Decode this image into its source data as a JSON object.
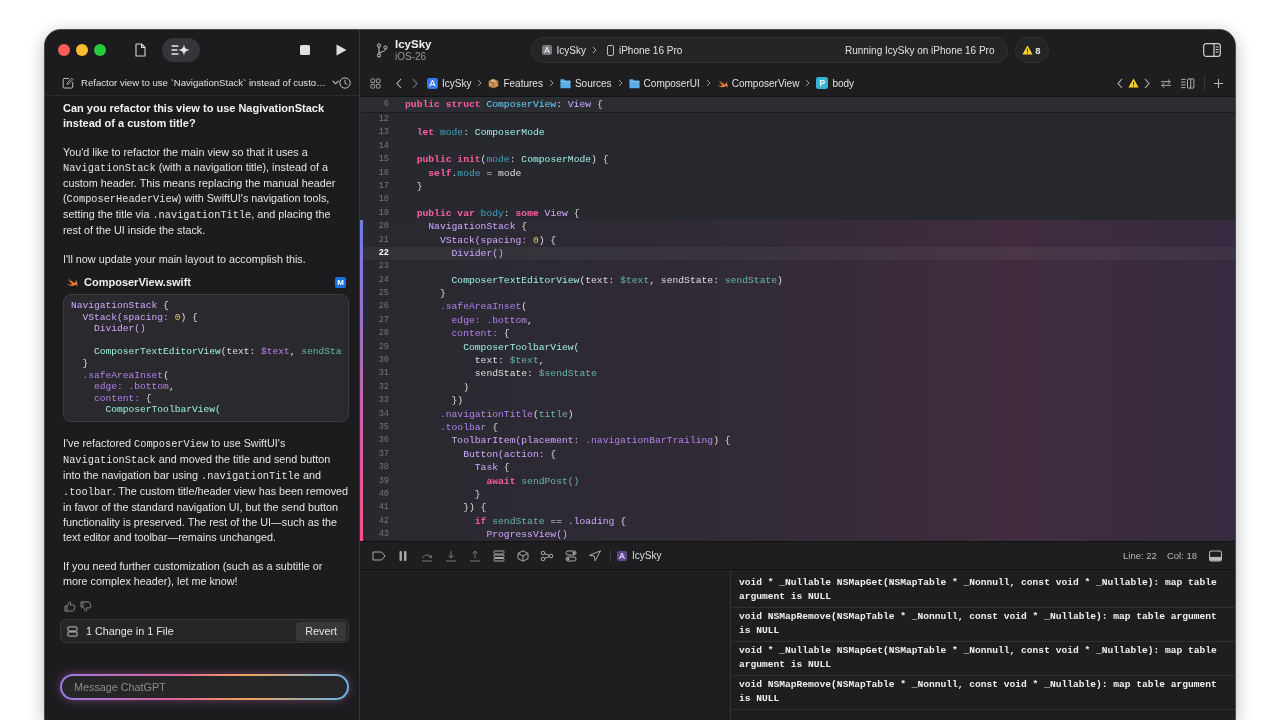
{
  "toolbar": {
    "assistant_toggle": {
      "selected": true
    },
    "project": {
      "name": "IcySky",
      "branch": "iOS-26"
    },
    "scheme": "IcySky",
    "destination": "iPhone 16 Pro",
    "status": "Running IcySky on iPhone 16 Pro",
    "warnings": "8"
  },
  "chat": {
    "title": "Refactor view to use `NavigationStack` instead of custo…",
    "items": [
      {
        "kind": "question",
        "text": "Can you refactor this view to use NagivationStack instead of a custom title?"
      },
      {
        "kind": "answer",
        "segments": [
          {
            "kind": "text",
            "text": "You'd like to refactor the main view so that it uses a "
          },
          {
            "kind": "code",
            "text": "NavigationStack"
          },
          {
            "kind": "text",
            "text": " (with a navigation title), instead of a custom header. This means replacing the manual header ("
          },
          {
            "kind": "code",
            "text": "ComposerHeaderView"
          },
          {
            "kind": "text",
            "text": ") with SwiftUI's navigation tools, setting the title via "
          },
          {
            "kind": "code",
            "text": ".navigationTitle"
          },
          {
            "kind": "text",
            "text": ", and placing the rest of the UI inside the stack."
          }
        ]
      },
      {
        "kind": "answer",
        "segments": [
          {
            "kind": "text",
            "text": "I'll now update your main layout to accomplish this."
          }
        ]
      },
      {
        "kind": "file",
        "name": "ComposerView.swift",
        "status": "M",
        "lines": [
          {
            "kind": "code",
            "tokens": [
              {
                "text": "NavigationStack",
                "kind": "type"
              },
              {
                "text": " {",
                "kind": "plain"
              }
            ]
          },
          {
            "kind": "code",
            "tokens": [
              {
                "text": "  VStack(spacing: ",
                "kind": "type"
              },
              {
                "text": "0",
                "kind": "number"
              },
              {
                "text": ") {",
                "kind": "plain"
              }
            ]
          },
          {
            "kind": "code",
            "tokens": [
              {
                "text": "    Divider()",
                "kind": "type"
              }
            ]
          },
          {
            "kind": "blank"
          },
          {
            "kind": "code",
            "tokens": [
              {
                "text": "    ComposerTextEditorView",
                "kind": "project"
              },
              {
                "text": "(text: ",
                "kind": "plain"
              },
              {
                "text": "$text",
                "kind": "member"
              },
              {
                "text": ", ",
                "kind": "plain"
              },
              {
                "text": "sendSta",
                "kind": "value"
              }
            ]
          },
          {
            "kind": "code",
            "tokens": [
              {
                "text": "  }",
                "kind": "plain"
              }
            ]
          },
          {
            "kind": "code",
            "tokens": [
              {
                "text": "  .safeAreaInset",
                "kind": "member"
              },
              {
                "text": "(",
                "kind": "plain"
              }
            ]
          },
          {
            "kind": "code",
            "tokens": [
              {
                "text": "    edge: .bottom",
                "kind": "member"
              },
              {
                "text": ",",
                "kind": "plain"
              }
            ]
          },
          {
            "kind": "code",
            "tokens": [
              {
                "text": "    content:",
                "kind": "member"
              },
              {
                "text": " {",
                "kind": "plain"
              }
            ]
          },
          {
            "kind": "code",
            "tokens": [
              {
                "text": "      ComposerToolbarView(",
                "kind": "project"
              }
            ]
          }
        ]
      },
      {
        "kind": "answer",
        "segments": [
          {
            "kind": "text",
            "text": "I've refactored "
          },
          {
            "kind": "code",
            "text": "ComposerView"
          },
          {
            "kind": "text",
            "text": " to use SwiftUI's "
          },
          {
            "kind": "code",
            "text": "NavigationStack"
          },
          {
            "kind": "text",
            "text": " and moved the title and send button into the navigation bar using "
          },
          {
            "kind": "code",
            "text": ".navigationTitle"
          },
          {
            "kind": "text",
            "text": " and "
          },
          {
            "kind": "code",
            "text": ".toolbar"
          },
          {
            "kind": "text",
            "text": ". The custom title/header view has been removed in favor of the standard navigation UI, but the send button functionality is preserved. The rest of the UI—such as the text editor and toolbar—remains unchanged."
          }
        ]
      },
      {
        "kind": "answer",
        "segments": [
          {
            "kind": "text",
            "text": "If you need further customization (such as a subtitle or more complex header), let me know!"
          }
        ]
      }
    ],
    "changes": {
      "summary": "1 Change in 1 File",
      "action": "Revert"
    },
    "input": {
      "placeholder": "Message ChatGPT"
    }
  },
  "breadcrumbs": [
    {
      "kind": "app",
      "label": "IcySky"
    },
    {
      "kind": "package",
      "label": "Features"
    },
    {
      "kind": "folder",
      "label": "Sources"
    },
    {
      "kind": "folder",
      "label": "ComposerUI"
    },
    {
      "kind": "swift",
      "label": "ComposerView"
    },
    {
      "kind": "symbol",
      "badge": "P",
      "label": "body"
    }
  ],
  "editor": {
    "sticky_line": {
      "number": "6",
      "tokens": [
        {
          "text": "public struct ",
          "kind": "keyword"
        },
        {
          "text": "ComposerView",
          "kind": "decl"
        },
        {
          "text": ": ",
          "kind": "plain"
        },
        {
          "text": "View",
          "kind": "type"
        },
        {
          "text": " {",
          "kind": "plain"
        }
      ]
    },
    "lines": [
      {
        "number": "12",
        "changed": false,
        "selected": false
      },
      {
        "number": "13",
        "changed": false,
        "selected": false,
        "tokens": [
          {
            "text": "  let ",
            "kind": "keyword"
          },
          {
            "text": "mode",
            "kind": "property"
          },
          {
            "text": ": ",
            "kind": "plain"
          },
          {
            "text": "ComposerMode",
            "kind": "project"
          }
        ]
      },
      {
        "number": "14",
        "changed": false,
        "selected": false
      },
      {
        "number": "15",
        "changed": false,
        "selected": false,
        "tokens": [
          {
            "text": "  public init",
            "kind": "keyword"
          },
          {
            "text": "(",
            "kind": "plain"
          },
          {
            "text": "mode",
            "kind": "property"
          },
          {
            "text": ": ",
            "kind": "plain"
          },
          {
            "text": "ComposerMode",
            "kind": "project"
          },
          {
            "text": ") {",
            "kind": "plain"
          }
        ]
      },
      {
        "number": "16",
        "changed": false,
        "selected": false,
        "tokens": [
          {
            "text": "    self",
            "kind": "keyword"
          },
          {
            "text": ".",
            "kind": "plain"
          },
          {
            "text": "mode",
            "kind": "property"
          },
          {
            "text": " = mode",
            "kind": "plain"
          }
        ]
      },
      {
        "number": "17",
        "changed": false,
        "selected": false,
        "tokens": [
          {
            "text": "  }",
            "kind": "plain"
          }
        ]
      },
      {
        "number": "18",
        "changed": false,
        "selected": false
      },
      {
        "number": "19",
        "changed": false,
        "selected": false,
        "tokens": [
          {
            "text": "  public var ",
            "kind": "keyword"
          },
          {
            "text": "body",
            "kind": "property"
          },
          {
            "text": ": ",
            "kind": "plain"
          },
          {
            "text": "some ",
            "kind": "keyword"
          },
          {
            "text": "View",
            "kind": "type"
          },
          {
            "text": " {",
            "kind": "plain"
          }
        ]
      },
      {
        "number": "20",
        "changed": true,
        "selected": false,
        "tokens": [
          {
            "text": "    NavigationStack",
            "kind": "type"
          },
          {
            "text": " {",
            "kind": "plain"
          }
        ]
      },
      {
        "number": "21",
        "changed": true,
        "selected": false,
        "tokens": [
          {
            "text": "      VStack(spacing: ",
            "kind": "type"
          },
          {
            "text": "0",
            "kind": "number"
          },
          {
            "text": ") {",
            "kind": "plain"
          }
        ]
      },
      {
        "number": "22",
        "changed": true,
        "selected": true,
        "tokens": [
          {
            "text": "        Divider()",
            "kind": "type"
          }
        ]
      },
      {
        "number": "23",
        "changed": true,
        "selected": false
      },
      {
        "number": "24",
        "changed": true,
        "selected": false,
        "tokens": [
          {
            "text": "        ComposerTextEditorView",
            "kind": "project"
          },
          {
            "text": "(text: ",
            "kind": "plain"
          },
          {
            "text": "$text",
            "kind": "value"
          },
          {
            "text": ", sendState: ",
            "kind": "plain"
          },
          {
            "text": "sendState",
            "kind": "value"
          },
          {
            "text": ")",
            "kind": "plain"
          }
        ]
      },
      {
        "number": "25",
        "changed": true,
        "selected": false,
        "tokens": [
          {
            "text": "      }",
            "kind": "plain"
          }
        ]
      },
      {
        "number": "26",
        "changed": true,
        "selected": false,
        "tokens": [
          {
            "text": "      .safeAreaInset",
            "kind": "member"
          },
          {
            "text": "(",
            "kind": "plain"
          }
        ]
      },
      {
        "number": "27",
        "changed": true,
        "selected": false,
        "tokens": [
          {
            "text": "        edge: .bottom",
            "kind": "member"
          },
          {
            "text": ",",
            "kind": "plain"
          }
        ]
      },
      {
        "number": "28",
        "changed": true,
        "selected": false,
        "tokens": [
          {
            "text": "        content:",
            "kind": "member"
          },
          {
            "text": " {",
            "kind": "plain"
          }
        ]
      },
      {
        "number": "29",
        "changed": true,
        "selected": false,
        "tokens": [
          {
            "text": "          ComposerToolbarView(",
            "kind": "project"
          }
        ]
      },
      {
        "number": "30",
        "changed": true,
        "selected": false,
        "tokens": [
          {
            "text": "            text: ",
            "kind": "plain"
          },
          {
            "text": "$text",
            "kind": "value"
          },
          {
            "text": ",",
            "kind": "plain"
          }
        ]
      },
      {
        "number": "31",
        "changed": true,
        "selected": false,
        "tokens": [
          {
            "text": "            sendState: ",
            "kind": "plain"
          },
          {
            "text": "$sendState",
            "kind": "value"
          }
        ]
      },
      {
        "number": "32",
        "changed": true,
        "selected": false,
        "tokens": [
          {
            "text": "          )",
            "kind": "plain"
          }
        ]
      },
      {
        "number": "33",
        "changed": true,
        "selected": false,
        "tokens": [
          {
            "text": "        })",
            "kind": "plain"
          }
        ]
      },
      {
        "number": "34",
        "changed": true,
        "selected": false,
        "tokens": [
          {
            "text": "      .navigationTitle",
            "kind": "member"
          },
          {
            "text": "(",
            "kind": "plain"
          },
          {
            "text": "title",
            "kind": "value"
          },
          {
            "text": ")",
            "kind": "plain"
          }
        ]
      },
      {
        "number": "35",
        "changed": true,
        "selected": false,
        "tokens": [
          {
            "text": "      .toolbar",
            "kind": "member"
          },
          {
            "text": " {",
            "kind": "plain"
          }
        ]
      },
      {
        "number": "36",
        "changed": true,
        "selected": false,
        "tokens": [
          {
            "text": "        ToolbarItem(placement: ",
            "kind": "type"
          },
          {
            "text": ".navigationBarTrailing",
            "kind": "member"
          },
          {
            "text": ") {",
            "kind": "plain"
          }
        ]
      },
      {
        "number": "37",
        "changed": true,
        "selected": false,
        "tokens": [
          {
            "text": "          Button(action: ",
            "kind": "type"
          },
          {
            "text": "{",
            "kind": "plain"
          }
        ]
      },
      {
        "number": "38",
        "changed": true,
        "selected": false,
        "tokens": [
          {
            "text": "            Task",
            "kind": "type"
          },
          {
            "text": " {",
            "kind": "plain"
          }
        ]
      },
      {
        "number": "39",
        "changed": true,
        "selected": false,
        "tokens": [
          {
            "text": "              await ",
            "kind": "keyword"
          },
          {
            "text": "sendPost()",
            "kind": "value"
          }
        ]
      },
      {
        "number": "40",
        "changed": true,
        "selected": false,
        "tokens": [
          {
            "text": "            }",
            "kind": "plain"
          }
        ]
      },
      {
        "number": "41",
        "changed": true,
        "selected": false,
        "tokens": [
          {
            "text": "          }) {",
            "kind": "plain"
          }
        ]
      },
      {
        "number": "42",
        "changed": true,
        "selected": false,
        "tokens": [
          {
            "text": "            if ",
            "kind": "keyword"
          },
          {
            "text": "sendState",
            "kind": "value"
          },
          {
            "text": " == ",
            "kind": "plain"
          },
          {
            "text": ".loading",
            "kind": "type"
          },
          {
            "text": " {",
            "kind": "plain"
          }
        ]
      },
      {
        "number": "43",
        "changed": true,
        "selected": false,
        "tokens": [
          {
            "text": "              ProgressView()",
            "kind": "type"
          }
        ]
      }
    ]
  },
  "debug_bar": {
    "target": "IcySky",
    "line": "Line: 22",
    "column": "Col: 18"
  },
  "console": {
    "messages": [
      "void * _Nullable NSMapGet(NSMapTable * _Nonnull, const void * _Nullable): map table argument is NULL",
      "void NSMapRemove(NSMapTable * _Nonnull, const void * _Nullable): map table argument is NULL",
      "void * _Nullable NSMapGet(NSMapTable * _Nonnull, const void * _Nullable): map table argument is NULL",
      "void NSMapRemove(NSMapTable * _Nonnull, const void * _Nullable): map table argument is NULL"
    ]
  }
}
